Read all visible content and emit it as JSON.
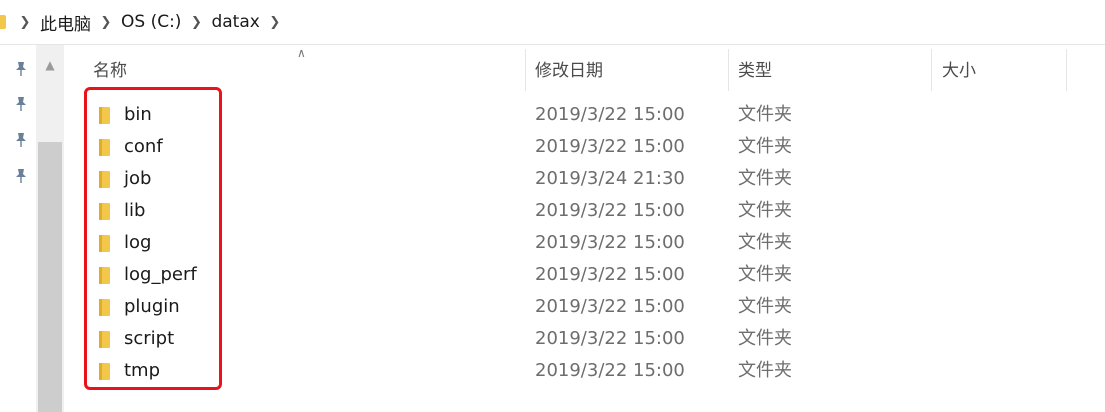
{
  "breadcrumb": [
    "此电脑",
    "OS (C:)",
    "datax"
  ],
  "columns": {
    "name": "名称",
    "date": "修改日期",
    "type": "类型",
    "size": "大小"
  },
  "files": [
    {
      "name": "bin",
      "date": "2019/3/22 15:00",
      "type": "文件夹"
    },
    {
      "name": "conf",
      "date": "2019/3/22 15:00",
      "type": "文件夹"
    },
    {
      "name": "job",
      "date": "2019/3/24 21:30",
      "type": "文件夹"
    },
    {
      "name": "lib",
      "date": "2019/3/22 15:00",
      "type": "文件夹"
    },
    {
      "name": "log",
      "date": "2019/3/22 15:00",
      "type": "文件夹"
    },
    {
      "name": "log_perf",
      "date": "2019/3/22 15:00",
      "type": "文件夹"
    },
    {
      "name": "plugin",
      "date": "2019/3/22 15:00",
      "type": "文件夹"
    },
    {
      "name": "script",
      "date": "2019/3/22 15:00",
      "type": "文件夹"
    },
    {
      "name": "tmp",
      "date": "2019/3/22 15:00",
      "type": "文件夹"
    }
  ],
  "icons": {
    "folder": "folder-icon",
    "pin": "pin-icon",
    "chevron": "chevron-right-icon",
    "sort": "sort-up-icon"
  },
  "colors": {
    "highlight": "#e8141b",
    "folder": "#f3c74a"
  }
}
